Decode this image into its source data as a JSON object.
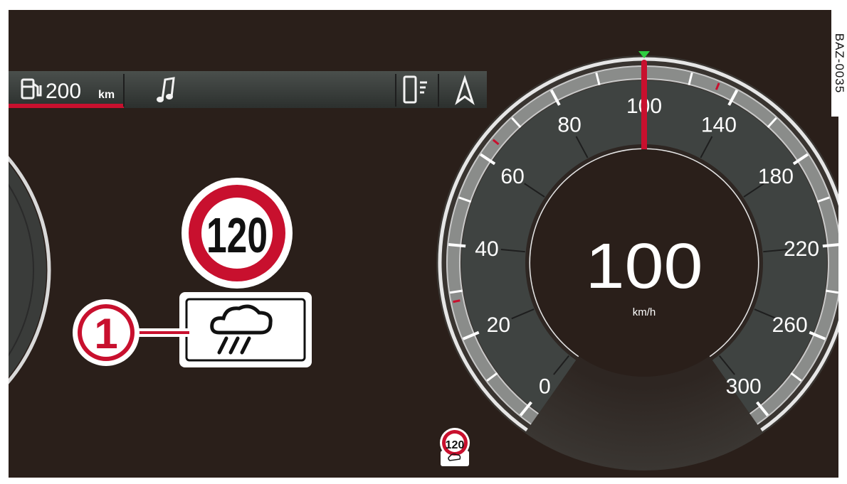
{
  "top_bar": {
    "range_value": "200",
    "range_unit": "km",
    "icons": [
      "fuel-pump-icon",
      "music-note-icon",
      "phone-icon",
      "navigation-arrow-icon"
    ]
  },
  "sign": {
    "speed_limit": "120",
    "callout_number": "1",
    "supplementary_icon": "rain-cloud-icon",
    "mini_speed_limit": "120"
  },
  "speedometer": {
    "ticks": [
      "0",
      "20",
      "40",
      "60",
      "80",
      "100",
      "140",
      "180",
      "220",
      "260",
      "300"
    ],
    "current_speed": "100",
    "unit": "km/h",
    "needle_value": 100
  },
  "document_id": "BAZ-0035",
  "colors": {
    "background": "#2a1f1a",
    "accent_red": "#c8102e",
    "needle_green": "#2ecc40",
    "gauge_face": "#3f4341"
  }
}
